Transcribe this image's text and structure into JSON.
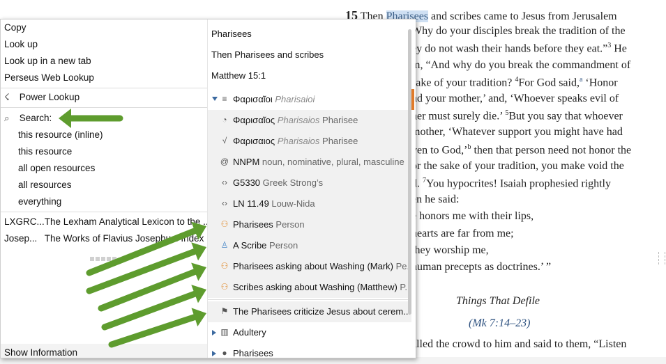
{
  "bible": {
    "lines": [
      {
        "num": "15",
        "pre": " Then ",
        "hl": "Pharisees",
        "post": " and scribes came to Jesus from Jerusalem"
      },
      {
        "text": "Why do your disciples break the tradition of the"
      },
      {
        "text": "ey do not wash their hands before they eat.”",
        "sup": "3",
        "rest": " He"
      },
      {
        "text": "m, “And why do you break the commandment of"
      },
      {
        "text": "sake of your tradition? ",
        "sup": "4",
        "rest": "For God said,",
        "sup2": "a",
        "rest2": " ‘Honor"
      },
      {
        "text": "nd your mother,’ and, ‘Whoever speaks evil of"
      },
      {
        "text": "her must surely die.’ ",
        "sup": "5",
        "rest": "But you say that whoever"
      },
      {
        "text": "mother, ‘Whatever support you might have had"
      },
      {
        "text": "ven to God,’",
        "sup": "b",
        "rest": " then that person need not honor the"
      },
      {
        "text": "or the sake of your tradition, you make void the"
      },
      {
        "text": "d. ",
        "sup": "7",
        "rest": "You hypocrites! Isaiah prophesied rightly"
      },
      {
        "text": "en he said:"
      },
      {
        "text": "e honors me with their lips,"
      },
      {
        "text": " hearts are far from me;"
      },
      {
        "text": "they worship me,"
      },
      {
        "text": "human precepts as doctrines.’ ”"
      }
    ],
    "heading": "Things That Defile",
    "heading_ref": "(Mk 7:14–23)",
    "last_line": "alled the crowd to him and said to them, “Listen"
  },
  "menu": {
    "copy": "Copy",
    "look_up": "Look up",
    "look_up_new_tab": "Look up in a new tab",
    "perseus": "Perseus Web Lookup",
    "power_lookup": "Power Lookup",
    "search": "Search:",
    "search_items": [
      "this resource (inline)",
      "this resource",
      "all open resources",
      "all resources",
      "everything"
    ],
    "resources": [
      {
        "abbr": "LXGRC...",
        "title": "The Lexham Analytical Lexicon to the ..."
      },
      {
        "abbr": "Josep...",
        "title": "The Works of Flavius Josephus: Index"
      }
    ],
    "show_information": "Show Information"
  },
  "context": {
    "heads": [
      "Pharisees",
      "Then Pharisees and scribes",
      "Matthew 15:1"
    ],
    "rows": [
      {
        "kind": "top",
        "tri": "down",
        "icon": "list-icon",
        "glyph": "≡",
        "greek": "Φαρισαῖοι",
        "gray": "Pharisaioi",
        "label": ""
      },
      {
        "kind": "sub",
        "icon": "lemma-icon",
        "glyph": "◔",
        "greek": "Φαρισαῖος",
        "gray": "Pharisaios",
        "label": "Pharisee"
      },
      {
        "kind": "sub",
        "icon": "root-icon",
        "glyph": "√",
        "greek": "Φαρισαιος",
        "gray": "Pharisaios",
        "label": "Pharisee"
      },
      {
        "kind": "sub",
        "icon": "morph-icon",
        "glyph": "@",
        "greek": "NNPM",
        "gray": "",
        "label": "noun, nominative, plural, masculine"
      },
      {
        "kind": "sub",
        "icon": "code-icon",
        "glyph": "‹›",
        "greek": "G5330",
        "gray": "",
        "label": "Greek Strong’s"
      },
      {
        "kind": "sub",
        "icon": "code-icon",
        "glyph": "‹›",
        "greek": "LN 11.49",
        "gray": "",
        "label": "Louw-Nida"
      },
      {
        "kind": "sub",
        "icon": "group-icon",
        "glyph": "⚇",
        "greek": "Pharisees",
        "gray": "",
        "label": "Person"
      },
      {
        "kind": "sub",
        "icon": "person-icon",
        "glyph": "♙",
        "greek": "A Scribe",
        "gray": "",
        "label": "Person"
      },
      {
        "kind": "sub",
        "icon": "group-icon",
        "glyph": "⚇",
        "greek": "Pharisees asking about Washing (Mark)",
        "gray": "",
        "label": "Pe..."
      },
      {
        "kind": "sub",
        "icon": "group-icon",
        "glyph": "⚇",
        "greek": "Scribes asking about Washing (Matthew)",
        "gray": "",
        "label": "P..."
      },
      {
        "kind": "sub",
        "icon": "flag-icon",
        "glyph": "⚑",
        "greek": "The Pharisees criticize Jesus about cerem...",
        "gray": "",
        "label": ""
      },
      {
        "kind": "top",
        "tri": "right",
        "icon": "topic-icon",
        "glyph": "▥",
        "greek": "Adultery",
        "gray": "",
        "label": ""
      },
      {
        "kind": "top",
        "tri": "right",
        "icon": "bubble-icon",
        "glyph": "●",
        "greek": "Pharisees",
        "gray": "",
        "label": ""
      }
    ]
  },
  "colors": {
    "arrow": "#5e9c2e",
    "highlight": "#cfe0f3",
    "selection_bar": "#e07b2a",
    "triangle": "#3c6aa0"
  }
}
